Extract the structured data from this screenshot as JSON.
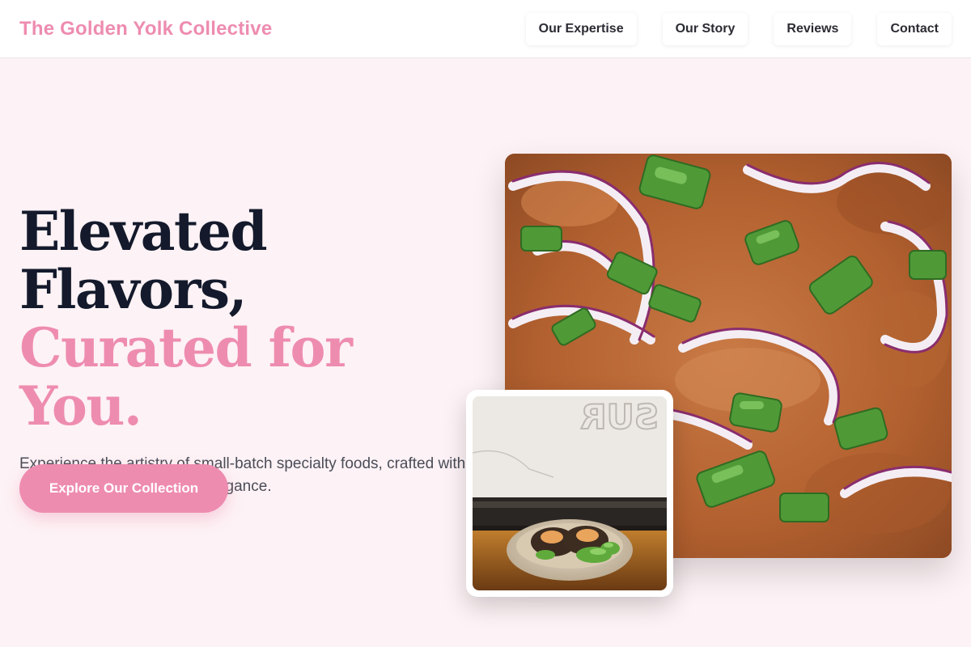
{
  "brand": {
    "name": "The Golden Yolk Collective"
  },
  "nav": {
    "items": [
      {
        "label": "Our Expertise"
      },
      {
        "label": "Our Story"
      },
      {
        "label": "Reviews"
      },
      {
        "label": "Contact"
      }
    ]
  },
  "hero": {
    "headline_line1": "Elevated",
    "headline_line2": "Flavors,",
    "headline_accent": "Curated for You.",
    "subtext": "Experience the artistry of small-batch specialty foods, crafted with passion and delivered with elegance.",
    "cta_label": "Explore Our Collection"
  },
  "images": {
    "main_photo": "food-photo-salad-onion-scallion",
    "inset_photo": "food-photo-bowl-window"
  },
  "colors": {
    "accent": "#ee8cb0",
    "headline": "#141a2c",
    "background": "#fdf2f5"
  }
}
